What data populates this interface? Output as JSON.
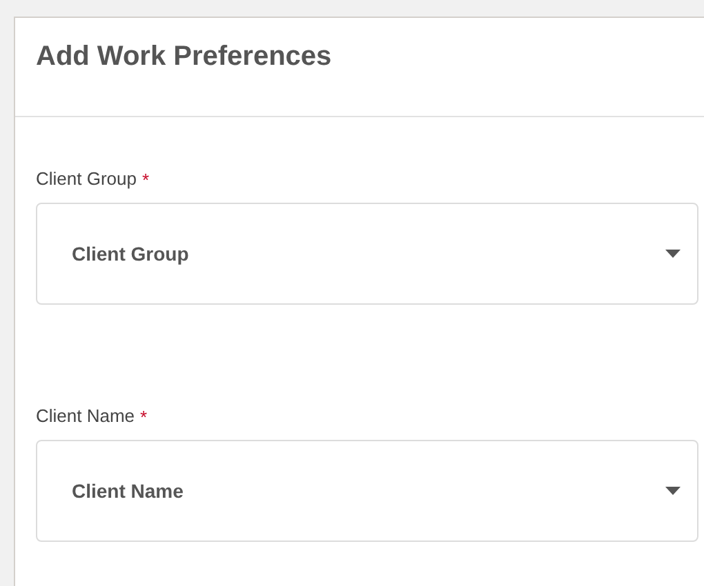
{
  "card": {
    "title": "Add Work Preferences"
  },
  "fields": [
    {
      "label": "Client Group",
      "required": true,
      "required_mark": "*",
      "placeholder": "Client Group"
    },
    {
      "label": "Client Name",
      "required": true,
      "required_mark": "*",
      "placeholder": "Client Name"
    }
  ]
}
